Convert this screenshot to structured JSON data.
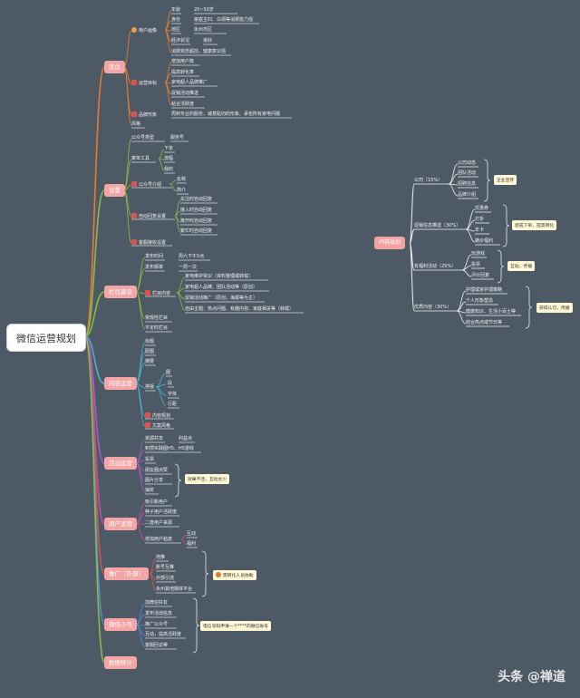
{
  "root": "微信运营规划",
  "watermark": "头条 @禅道",
  "branches": [
    {
      "label": "定位"
    },
    {
      "label": "设置"
    },
    {
      "label": "栏目建设"
    },
    {
      "label": "内容运营"
    },
    {
      "label": "活动运营"
    },
    {
      "label": "用户运营"
    },
    {
      "label": "推广（外部）"
    },
    {
      "label": "微信小号"
    },
    {
      "label": "数据统计"
    }
  ],
  "texts": {
    "a1": "年龄",
    "a1v": "20~50岁",
    "a2": "身份",
    "a2v": "家庭主妇、白领等消费能力强",
    "a3": "地区",
    "a3v": "永州市区",
    "a4": "经济状况",
    "a4v": "良好",
    "a5": "消费观念超前，健康意识强",
    "a_user": "用户画像",
    "b1": "增加用户数",
    "b2": "提高转化率",
    "b3": "家电超人品牌推广",
    "b4": "促销活动推送",
    "b5": "粘合活跃度",
    "b_goal": "运营目标",
    "c_brand": "品牌形象",
    "c1": "周到专业的服务、诚意贴切的形象、承包所有家电问题",
    "c_style": "风格",
    "s1": "公众号类型",
    "s1v": "服务号",
    "s2": "菜单工具",
    "s2a": "下单",
    "s2b": "流程",
    "s2c": "我的",
    "s3": "公众号介绍",
    "s3a": "名称",
    "s3b": "简介",
    "s4": "自动回复设置",
    "s4a": "关注时自动回复",
    "s4b": "接入时自动回复",
    "s4c": "离开时自动回复",
    "s4d": "繁忙时自动回复",
    "s5": "客服接收设置",
    "k1": "发布时间",
    "k1v": "周六下午5点",
    "k2": "发布频率",
    "k2v": "一周一次",
    "k3": "栏目内容",
    "k3a": "家电维护常识（资料整理或转载）",
    "k3b": "家电超人品牌、团队活动等（原创）",
    "k3c": "促销活动推广（原创，海报等为主）",
    "k3d": "自由主题：热点问题、有趣内容、家庭相关等（转载）",
    "k4": "常规性栏目",
    "k5": "不定时栏目",
    "n1": "标题",
    "n2": "配图",
    "n3": "摘要",
    "n4": "图",
    "n5": "排版",
    "n5a": "段",
    "n5b": "字体",
    "n5c": "行距",
    "n6": "内容规划",
    "n7": "文案风格",
    "e1": "资源共享",
    "e1v": "利益点",
    "e2": "积攒实践图H5、H5游戏",
    "e3": "投票",
    "e4": "朋友圈点赞",
    "e5": "图片分享",
    "e6": "抽奖",
    "e_note": "效果不佳，互动太少",
    "u1": "吸引新用户",
    "u2": "种子用户活跃度",
    "u3": "二度用户来源",
    "u4": "增加用户粘度",
    "u4a": "互动",
    "u4b": "福利",
    "p1": "地推",
    "p2": "账号互推",
    "p3": "外部引流",
    "p4": "永州其他媒体平台",
    "p_note": "需转化人员协助",
    "w1": "加微信好友",
    "w2": "发布活动信息",
    "w3": "推广公众号",
    "w4": "互动，提高活跃度",
    "w5": "客服回访等",
    "w_note": "电信号码申请一个****的微信账号"
  },
  "right": {
    "root": "内容规划",
    "g1": "公司（15%）",
    "g1a": "公司动态",
    "g1b": "团队活动",
    "g1c": "招聘信息",
    "g1d": "品牌介绍",
    "g1n": "企业宣传",
    "g2": "促销信息推送（30%）",
    "g2a": "优惠券",
    "g2b": "打折",
    "g2c": "年卡",
    "g2d": "路价福利",
    "g2n": "促成下单，提高转化",
    "g3": "有福利活动（25%）",
    "g3a": "玩游戏",
    "g3b": "投票",
    "g3c": "评价回复",
    "g3n": "互动，传播",
    "g4": "优质内容（30%）",
    "g4a": "护理或家护理策略",
    "g4b": "个人形象塑造",
    "g4c": "健康知识、生活小百士等",
    "g4d": "结合热点或节日等",
    "g4n": "获得认可，传播"
  }
}
